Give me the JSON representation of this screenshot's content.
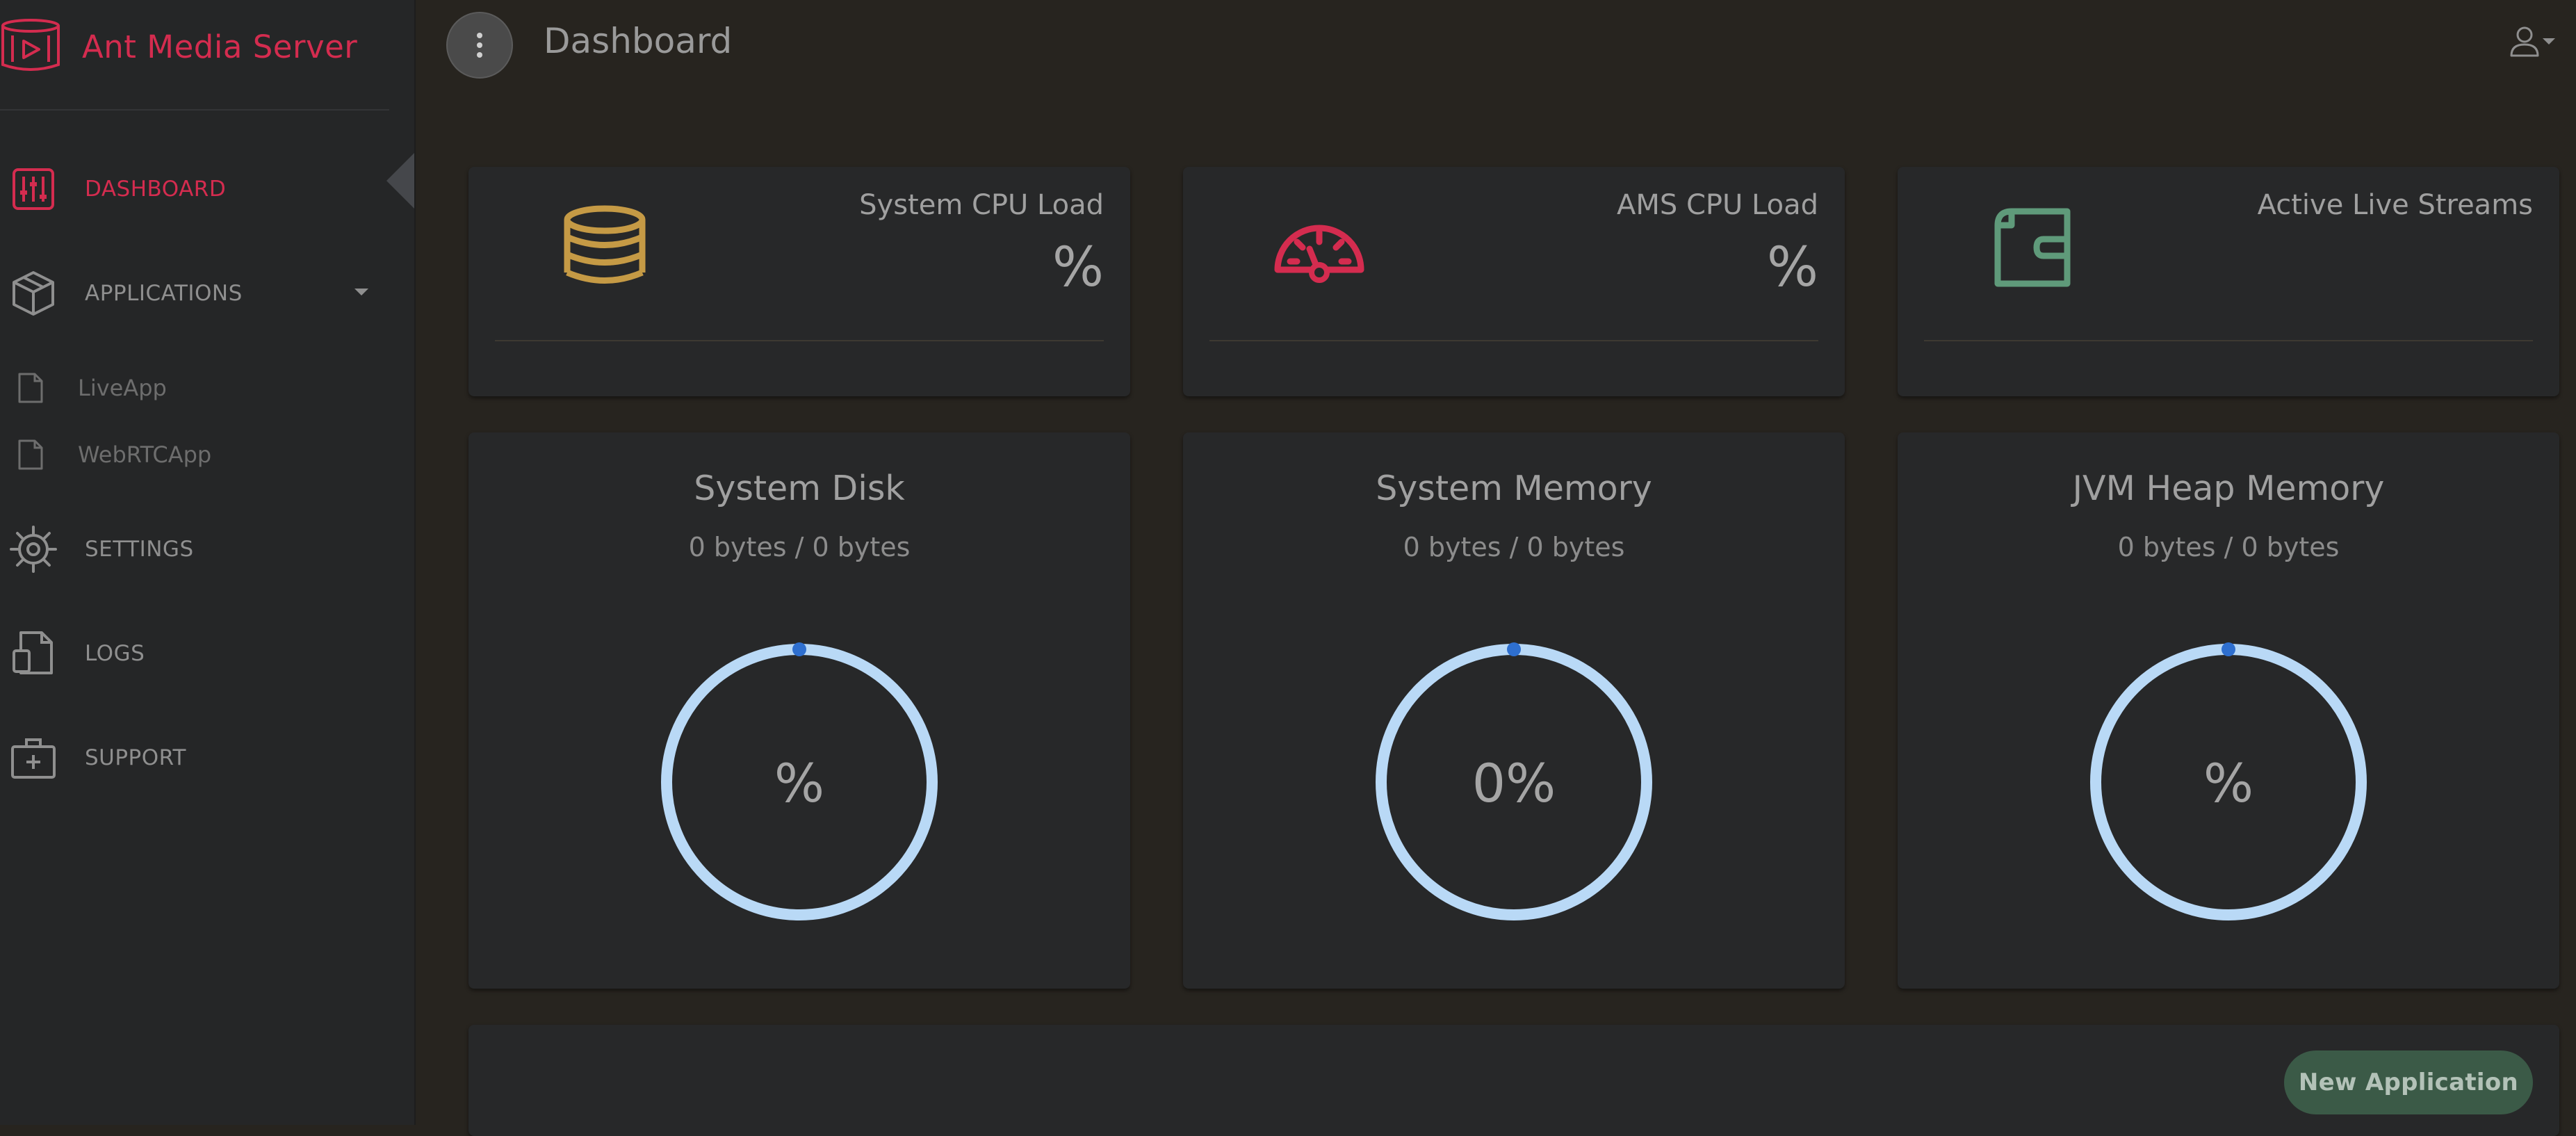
{
  "brand": {
    "name": "Ant Media Server",
    "logo_icon": "ant-media-logo-icon"
  },
  "sidebar": {
    "items": [
      {
        "label": "DASHBOARD",
        "icon": "sliders-icon",
        "active": true
      },
      {
        "label": "APPLICATIONS",
        "icon": "box-icon",
        "active": false,
        "expandable": true
      },
      {
        "label": "SETTINGS",
        "icon": "gear-icon",
        "active": false
      },
      {
        "label": "LOGS",
        "icon": "logs-file-icon",
        "active": false
      },
      {
        "label": "SUPPORT",
        "icon": "first-aid-kit-icon",
        "active": false
      }
    ],
    "applications": [
      {
        "label": "LiveApp",
        "icon": "file-icon"
      },
      {
        "label": "WebRTCApp",
        "icon": "file-icon"
      }
    ]
  },
  "header": {
    "title": "Dashboard",
    "menu_icon": "kebab-menu-icon",
    "user_icon": "user-icon"
  },
  "stats": [
    {
      "title": "System CPU Load",
      "value": "%",
      "icon": "database-icon",
      "color": "#c59a45"
    },
    {
      "title": "AMS CPU Load",
      "value": "%",
      "icon": "speedometer-icon",
      "color": "#d42c4f"
    },
    {
      "title": "Active Live Streams",
      "value": "",
      "icon": "wallet-icon",
      "color": "#5f9a7a"
    }
  ],
  "gauges": [
    {
      "title": "System Disk",
      "usage": "0 bytes / 0 bytes",
      "percent_text": "%",
      "percent": 0
    },
    {
      "title": "System Memory",
      "usage": "0 bytes / 0 bytes",
      "percent_text": "0%",
      "percent": 0
    },
    {
      "title": "JVM Heap Memory",
      "usage": "0 bytes / 0 bytes",
      "percent_text": "%",
      "percent": 0
    }
  ],
  "gauge_colors": {
    "ring": "#b9d9f6",
    "marker": "#2e6fcf"
  },
  "actions": {
    "new_application": "New Application"
  },
  "colors": {
    "accent": "#d42c4f",
    "button": "#3b5a47",
    "background": "#27241f",
    "sidebar": "#252627",
    "card": "#272829"
  }
}
